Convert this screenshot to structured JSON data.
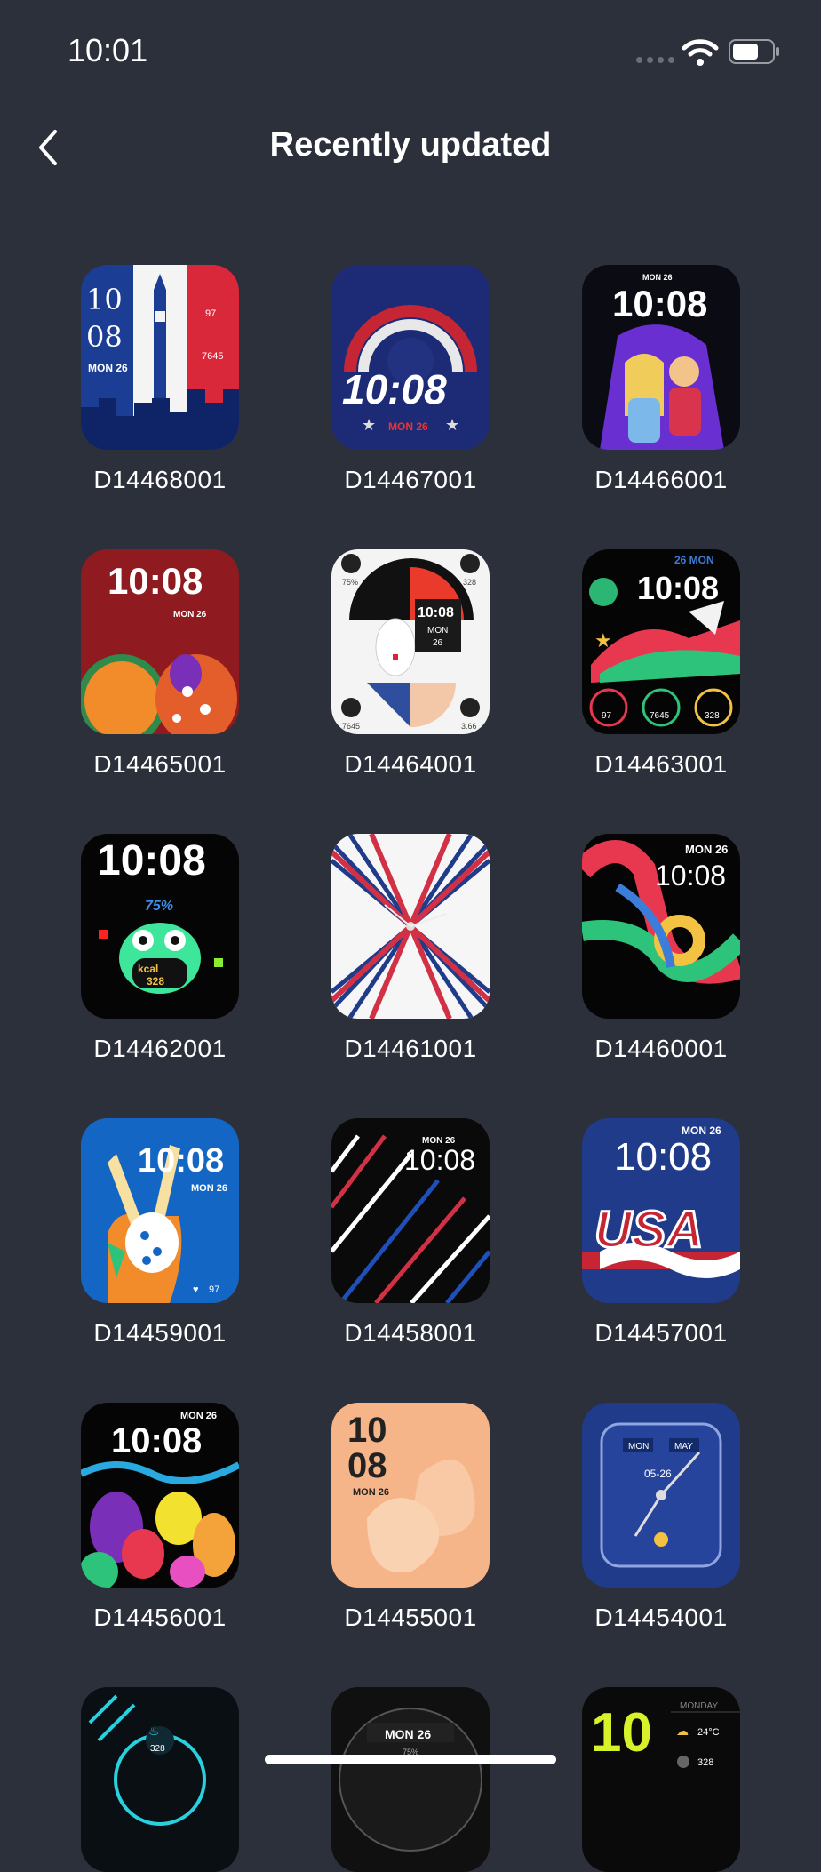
{
  "status": {
    "time": "10:01"
  },
  "header": {
    "title": "Recently updated"
  },
  "colors": {
    "background": "#2c303a",
    "text": "#ffffff"
  },
  "faces": [
    {
      "code": "D14468001",
      "t1": "10",
      "t2": "08",
      "date": "MON 26",
      "s1": "97",
      "s2": "7645"
    },
    {
      "code": "D14467001",
      "time": "10:08",
      "date": "MON 26"
    },
    {
      "code": "D14466001",
      "time": "10:08",
      "date": "MON 26"
    },
    {
      "code": "D14465001",
      "time": "10:08",
      "date": "MON 26"
    },
    {
      "code": "D14464001",
      "time": "10:08",
      "date": "MON",
      "day": "26",
      "s1": "75%",
      "s2": "328",
      "s3": "7645",
      "s4": "3.66"
    },
    {
      "code": "D14463001",
      "time": "10:08",
      "date": "26 MON",
      "s1": "97",
      "s2": "7645",
      "s3": "328"
    },
    {
      "code": "D14462001",
      "time": "10:08",
      "pct": "75%",
      "kcal": "kcal",
      "num": "328"
    },
    {
      "code": "D14461001"
    },
    {
      "code": "D14460001",
      "time": "10:08",
      "date": "MON 26"
    },
    {
      "code": "D14459001",
      "time": "10:08",
      "date": "MON 26",
      "s1": "97"
    },
    {
      "code": "D14458001",
      "time": "10:08",
      "date": "MON 26"
    },
    {
      "code": "D14457001",
      "time": "10:08",
      "date": "MON 26",
      "logo": "USA"
    },
    {
      "code": "D14456001",
      "time": "10:08",
      "date": "MON 26"
    },
    {
      "code": "D14455001",
      "t1": "10",
      "t2": "08",
      "date": "MON 26"
    },
    {
      "code": "D14454001",
      "day": "MON",
      "month": "MAY",
      "date": "05-26"
    }
  ],
  "partial_faces": [
    {
      "num": "328"
    },
    {
      "date": "MON   26",
      "pct": "75%"
    },
    {
      "big": "10",
      "label": "MONDAY",
      "temp": "24°C",
      "num": "328"
    }
  ]
}
